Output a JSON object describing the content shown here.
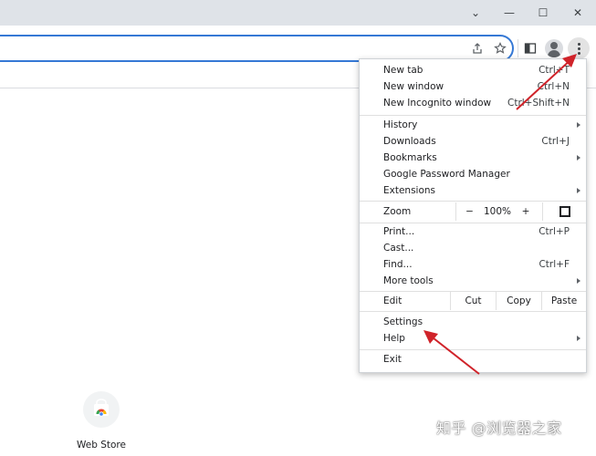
{
  "window_controls": {
    "chevron": "⌄",
    "minimize": "—",
    "maximize": "☐",
    "close": "✕"
  },
  "toolbar_icons": [
    "share-icon",
    "bookmark-star-icon",
    "side-panel-icon",
    "profile-icon",
    "more-menu-icon"
  ],
  "menu": {
    "group1": [
      {
        "label": "New tab",
        "shortcut": "Ctrl+T"
      },
      {
        "label": "New window",
        "shortcut": "Ctrl+N"
      },
      {
        "label": "New Incognito window",
        "shortcut": "Ctrl+Shift+N"
      }
    ],
    "group2": [
      {
        "label": "History"
      },
      {
        "label": "Downloads",
        "shortcut": "Ctrl+J"
      },
      {
        "label": "Bookmarks"
      },
      {
        "label": "Google Password Manager"
      },
      {
        "label": "Extensions"
      }
    ],
    "zoom": {
      "label": "Zoom",
      "minus": "−",
      "value": "100%",
      "plus": "+"
    },
    "group3": [
      {
        "label": "Print...",
        "shortcut": "Ctrl+P"
      },
      {
        "label": "Cast..."
      },
      {
        "label": "Find...",
        "shortcut": "Ctrl+F"
      },
      {
        "label": "More tools"
      }
    ],
    "edit": {
      "label": "Edit",
      "cut": "Cut",
      "copy": "Copy",
      "paste": "Paste"
    },
    "group4": [
      {
        "label": "Settings"
      },
      {
        "label": "Help"
      }
    ],
    "exit": {
      "label": "Exit"
    }
  },
  "shortcut_tile": {
    "label": "Web Store"
  },
  "watermark": "知乎 @浏览器之家",
  "colors": {
    "annotation_arrow": "#d0232a",
    "omnibox_border": "#3578d5"
  }
}
